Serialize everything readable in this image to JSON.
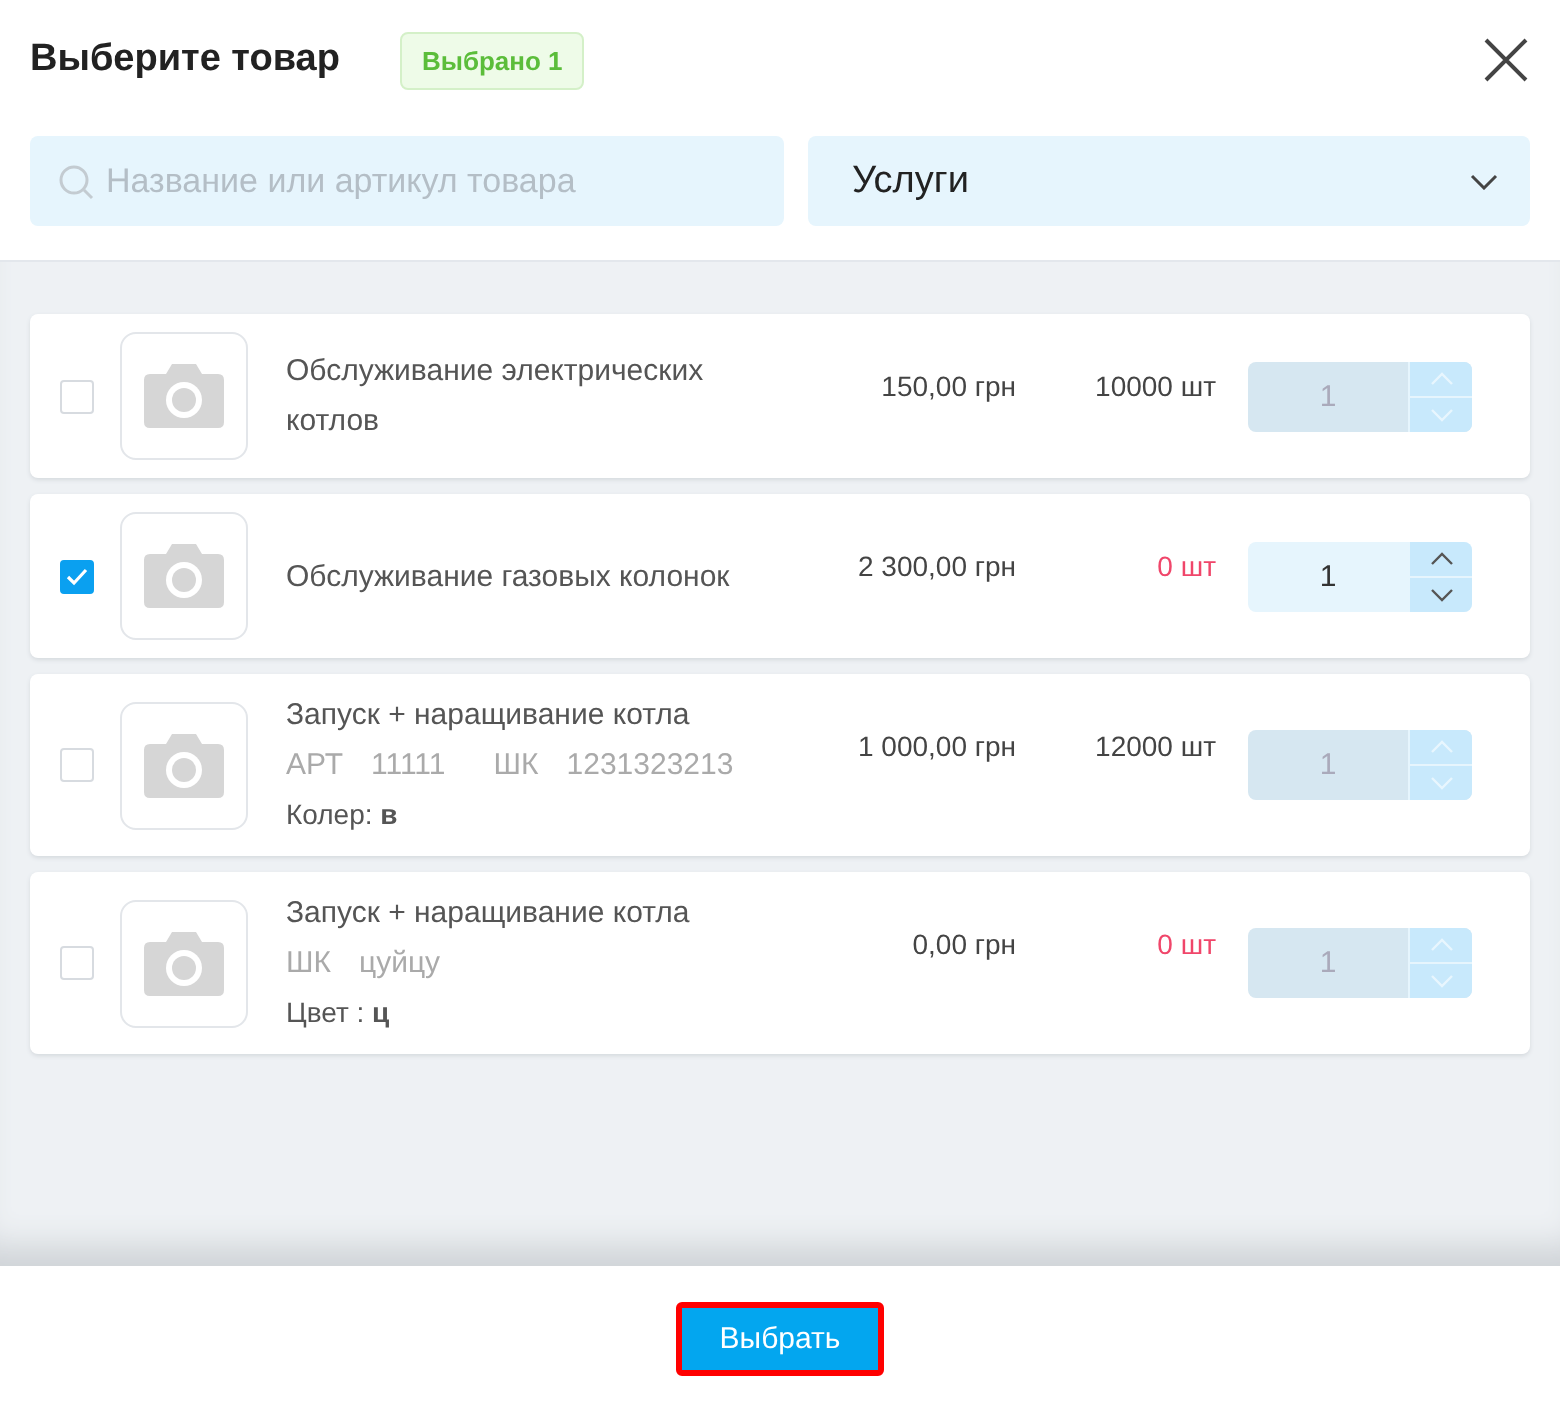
{
  "dialog": {
    "title": "Выберите товар",
    "selected_badge": "Выбрано 1"
  },
  "search": {
    "placeholder": "Название или артикул товара"
  },
  "category_select": {
    "value": "Услуги"
  },
  "products": [
    {
      "name": "Обслуживание электрических котлов",
      "price": "150,00 грн",
      "stock": "10000 шт",
      "in_stock": true,
      "checked": false,
      "quantity": "1"
    },
    {
      "name": "Обслуживание газовых колонок",
      "price": "2 300,00 грн",
      "stock": "0 шт",
      "in_stock": false,
      "checked": true,
      "quantity": "1"
    },
    {
      "name": "Запуск + наращивание котла",
      "codes": [
        {
          "label": "АРТ",
          "value": "11111"
        },
        {
          "label": "ШК",
          "value": "1231323213"
        }
      ],
      "attribute": "Колер: **в**",
      "price": "1 000,00 грн",
      "stock": "12000 шт",
      "in_stock": true,
      "checked": false,
      "quantity": "1"
    },
    {
      "name": "Запуск + наращивание котла",
      "codes": [
        {
          "label": "ШК",
          "value": "цуйцу"
        }
      ],
      "attribute": "Цвет : **ц**",
      "price": "0,00 грн",
      "stock": "0 шт",
      "in_stock": false,
      "checked": false,
      "quantity": "1"
    }
  ],
  "footer": {
    "button": "Выбрать"
  }
}
